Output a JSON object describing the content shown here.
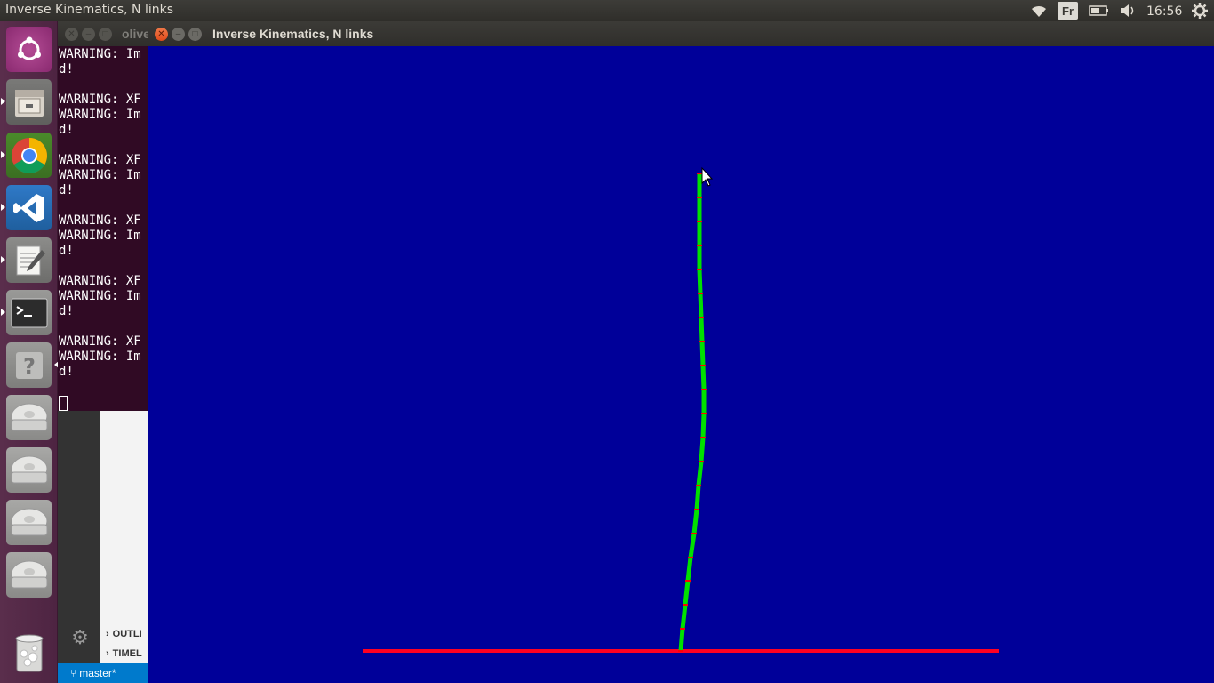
{
  "top_panel": {
    "title": "Inverse Kinematics, N links",
    "keyboard_layout": "Fr",
    "clock": "16:56",
    "icons": [
      "wifi-icon",
      "keyboard-layout-indicator",
      "battery-icon",
      "volume-icon",
      "settings-gear-icon"
    ]
  },
  "launcher": {
    "items": [
      {
        "name": "ubuntu-dash-icon"
      },
      {
        "name": "files-icon"
      },
      {
        "name": "chrome-icon"
      },
      {
        "name": "vscode-icon"
      },
      {
        "name": "text-editor-icon"
      },
      {
        "name": "terminal-icon"
      },
      {
        "name": "help-icon"
      },
      {
        "name": "drive-icon"
      },
      {
        "name": "drive-icon"
      },
      {
        "name": "drive-icon"
      },
      {
        "name": "drive-icon"
      },
      {
        "name": "trash-icon"
      }
    ]
  },
  "terminal": {
    "title": "olive",
    "lines": "WARNING: Im\nd!\n\nWARNING: XF\nWARNING: Im\nd!\n\nWARNING: XF\nWARNING: Im\nd!\n\nWARNING: XF\nWARNING: Im\nd!\n\nWARNING: XF\nWARNING: Im\nd!\n\nWARNING: XF\nWARNING: Im\nd!"
  },
  "vscode": {
    "sections": [
      "OUTLI",
      "TIMEL"
    ],
    "branch": "master*"
  },
  "ik_window": {
    "title": "Inverse Kinematics, N links",
    "colors": {
      "background": "#000099",
      "arm": "#00e000",
      "joints": "#ff0000",
      "ground": "#ff0022"
    }
  }
}
